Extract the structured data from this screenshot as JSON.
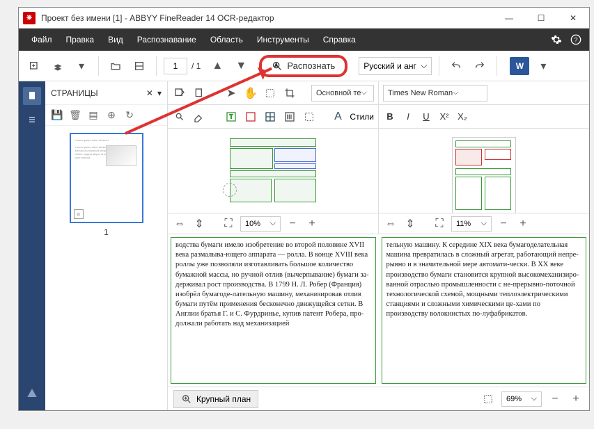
{
  "title": "Проект без имени [1] - ABBYY FineReader 14 OCR-редактор",
  "menu": {
    "file": "Файл",
    "edit": "Правка",
    "view": "Вид",
    "recog": "Распознавание",
    "area": "Область",
    "tools": "Инструменты",
    "help": "Справка"
  },
  "toolbar": {
    "page_current": "1",
    "page_total": "/ 1",
    "recognize": "Распознать",
    "lang": "Русский и анг",
    "word": "W"
  },
  "pages": {
    "title": "СТРАНИЦЫ",
    "thumb_num": "1"
  },
  "left_pane": {
    "style_sel": "Основной те",
    "font_sel": "Times New Roman",
    "styles_btn": "Стили",
    "zoom": "10%"
  },
  "right_pane": {
    "zoom": "11%"
  },
  "text_left": "водства бумаги имело изобретение во второй половине XVII века размалыва-ющего аппарата — ролла. В конце XVIII века роллы уже позволяли изготавливать большое количество бумажной массы, но ручной отлив (вычерпывание) бумаги за-держивал рост производства. В 1799 Н. Л. Робер (Франция) изобрёл бумагоде-лательную машину, механизировав отлив бумаги путём применения бесконечно движущейся сетки. В Англии братья Г. и С. Фурдринье, купив патент Робера, про-должали работать над механизацией",
  "text_right": "тельную машину. К середине XIX века бумагоделательная машина превратилась в сложный агрегат, работающий непре-рывно и в значительной мере автомати-чески. В XX веке производство бумаги становится крупной высокомеханизиро-ванной отраслью промышленности с не-прерывно-поточной технологической схемой, мощными теплоэлектрическими станциями и сложными химическими це-хами по производству волокнистых по-луфабрикатов.",
  "big_view": {
    "label": "Крупный план",
    "zoom": "69%"
  },
  "fmt": {
    "bold": "B",
    "italic": "I",
    "underline": "U",
    "sup": "X²",
    "sub": "X₂",
    "style_a": "A"
  }
}
